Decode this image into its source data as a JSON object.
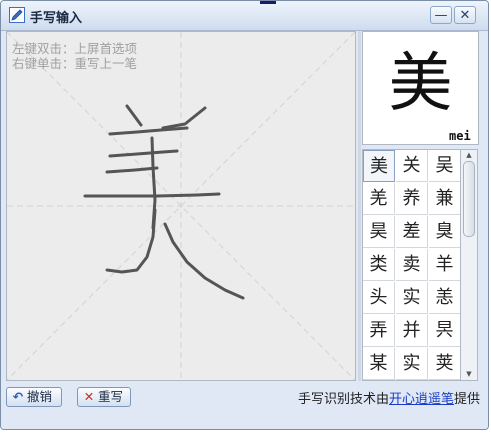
{
  "window": {
    "title": "手写输入",
    "minimize_icon": "minimize-icon",
    "close_icon": "close-icon"
  },
  "canvas": {
    "hint_line1": "左键双击：上屏首选项",
    "hint_line2": "右键单击：重写上一笔",
    "stroke_color": "#555555"
  },
  "preview": {
    "character": "美",
    "pinyin": "mei"
  },
  "candidates": [
    "美",
    "关",
    "吴",
    "羌",
    "养",
    "兼",
    "昊",
    "差",
    "臭",
    "类",
    "卖",
    "羊",
    "头",
    "实",
    "恙",
    "弄",
    "并",
    "昗",
    "某",
    "实",
    "荚"
  ],
  "buttons": {
    "undo_label": "撤销",
    "undo_icon": "undo-arrow-icon",
    "rewrite_label": "重写",
    "rewrite_icon": "x-icon"
  },
  "credit": {
    "prefix": "手写识别技术由",
    "link": "开心逍遥笔",
    "suffix": "提供"
  },
  "colors": {
    "accent": "#3a6fc4",
    "link": "#1a3cc8",
    "hint_text": "#a0a0a0"
  }
}
